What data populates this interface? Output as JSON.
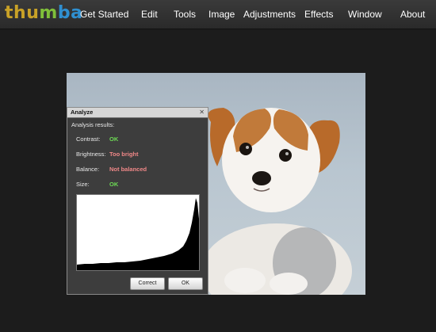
{
  "app": {
    "logo_letters": [
      {
        "char": "t",
        "color": "#c9a227"
      },
      {
        "char": "h",
        "color": "#c9a227"
      },
      {
        "char": "u",
        "color": "#c9a227"
      },
      {
        "char": "m",
        "color": "#7fbf3a"
      },
      {
        "char": "b",
        "color": "#2f8fd0"
      },
      {
        "char": "a",
        "color": "#2f8fd0"
      }
    ]
  },
  "menu": [
    {
      "id": "get-started",
      "label": "Get Started"
    },
    {
      "id": "edit",
      "label": "Edit"
    },
    {
      "id": "tools",
      "label": "Tools"
    },
    {
      "id": "image",
      "label": "Image"
    },
    {
      "id": "adjustments",
      "label": "Adjustments"
    },
    {
      "id": "effects",
      "label": "Effects"
    },
    {
      "id": "window",
      "label": "Window"
    },
    {
      "id": "about",
      "label": "About"
    }
  ],
  "dialog": {
    "title": "Analyze",
    "close_icon": "close-icon",
    "results_label": "Analysis results:",
    "rows": [
      {
        "label": "Contrast:",
        "value": "OK",
        "status": "ok"
      },
      {
        "label": "Brightness:",
        "value": "Too bright",
        "status": "bad"
      },
      {
        "label": "Balance:",
        "value": "Not balanced",
        "status": "bad"
      },
      {
        "label": "Size:",
        "value": "OK",
        "status": "ok"
      }
    ],
    "buttons": {
      "correct": "Correct",
      "ok": "OK"
    }
  },
  "colors": {
    "ok": "#6edc55",
    "bad": "#f08888",
    "menubar": "#333333",
    "background": "#1c1c1c"
  }
}
